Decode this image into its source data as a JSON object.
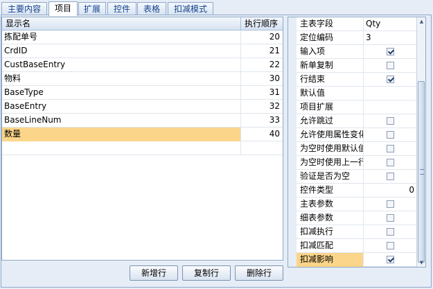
{
  "tabs": [
    "主要内容",
    "项目",
    "扩展",
    "控件",
    "表格",
    "扣减模式"
  ],
  "active_tab": "项目",
  "grid": {
    "columns": [
      "显示名",
      "执行顺序"
    ],
    "rows": [
      {
        "name": "拣配单号",
        "order": "20"
      },
      {
        "name": "CrdID",
        "order": "21"
      },
      {
        "name": "CustBaseEntry",
        "order": "22"
      },
      {
        "name": "物料",
        "order": "30"
      },
      {
        "name": "BaseType",
        "order": "31"
      },
      {
        "name": "BaseEntry",
        "order": "32"
      },
      {
        "name": "BaseLineNum",
        "order": "33"
      },
      {
        "name": "数量",
        "order": "40"
      }
    ],
    "selected_row": "数量"
  },
  "buttons": {
    "add": "新增行",
    "copy": "复制行",
    "delete": "删除行"
  },
  "properties": [
    {
      "label": "主表字段",
      "value": "Qty"
    },
    {
      "label": "定位编码",
      "value": "3"
    },
    {
      "label": "输入项",
      "checked": true
    },
    {
      "label": "新单复制",
      "checked": false
    },
    {
      "label": "行结束",
      "checked": true
    },
    {
      "label": "默认值",
      "value": ""
    },
    {
      "label": "项目扩展",
      "value": ""
    },
    {
      "label": "允许跳过",
      "checked": false
    },
    {
      "label": "允许使用属性变化",
      "checked": false
    },
    {
      "label": "为空时使用默认值",
      "checked": false
    },
    {
      "label": "为空时使用上一行",
      "checked": false
    },
    {
      "label": "验证是否为空",
      "checked": false
    },
    {
      "label": "控件类型",
      "value": "0"
    },
    {
      "label": "主表参数",
      "checked": false
    },
    {
      "label": "细表参数",
      "checked": false
    },
    {
      "label": "扣减执行",
      "checked": false
    },
    {
      "label": "扣减匹配",
      "checked": false
    },
    {
      "label": "扣减影响",
      "checked": true
    }
  ],
  "highlighted_property": "扣减影响"
}
